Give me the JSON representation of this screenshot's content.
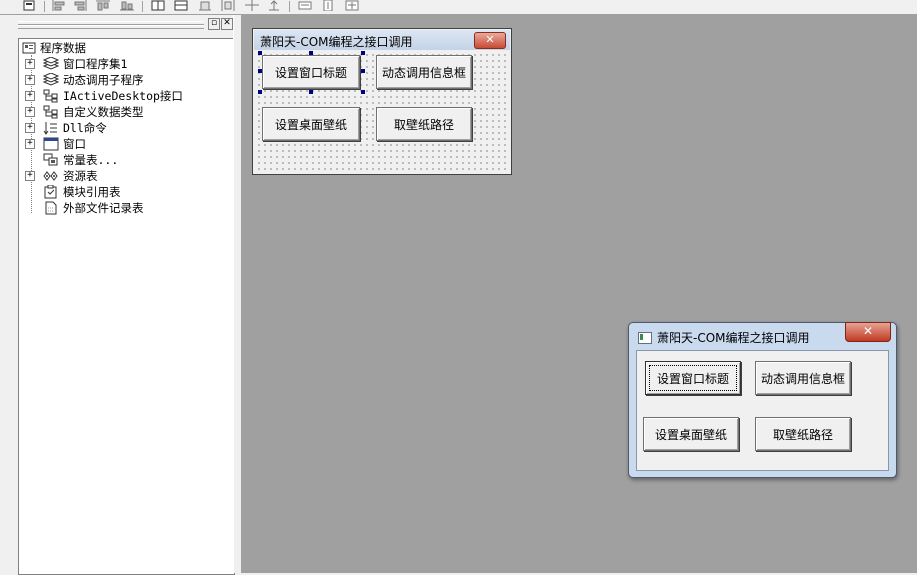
{
  "tree": {
    "root": "程序数据",
    "items": [
      {
        "label": "窗口程序集1",
        "icon": "stack-icon",
        "expandable": true
      },
      {
        "label": "动态调用子程序",
        "icon": "stack-icon",
        "expandable": true
      },
      {
        "label": "IActiveDesktop接口",
        "icon": "class-icon",
        "expandable": true
      },
      {
        "label": "自定义数据类型",
        "icon": "class-icon",
        "expandable": true
      },
      {
        "label": "Dll命令",
        "icon": "dll-icon",
        "expandable": true
      },
      {
        "label": "窗口",
        "icon": "window-icon",
        "expandable": true
      },
      {
        "label": "常量表...",
        "icon": "constant-icon",
        "expandable": false
      },
      {
        "label": "资源表",
        "icon": "resource-icon",
        "expandable": true
      },
      {
        "label": "模块引用表",
        "icon": "module-icon",
        "expandable": false
      },
      {
        "label": "外部文件记录表",
        "icon": "file-icon",
        "expandable": false
      }
    ]
  },
  "design_form": {
    "title": "萧阳天-COM编程之接口调用",
    "close_label": "✕",
    "buttons": [
      "设置窗口标题",
      "动态调用信息框",
      "设置桌面壁纸",
      "取壁纸路径"
    ]
  },
  "run_window": {
    "title": "萧阳天-COM编程之接口调用",
    "close_label": "✕",
    "buttons": [
      "设置窗口标题",
      "动态调用信息框",
      "设置桌面壁纸",
      "取壁纸路径"
    ]
  },
  "panel_controls": {
    "restore": "▫",
    "close": "✕"
  }
}
